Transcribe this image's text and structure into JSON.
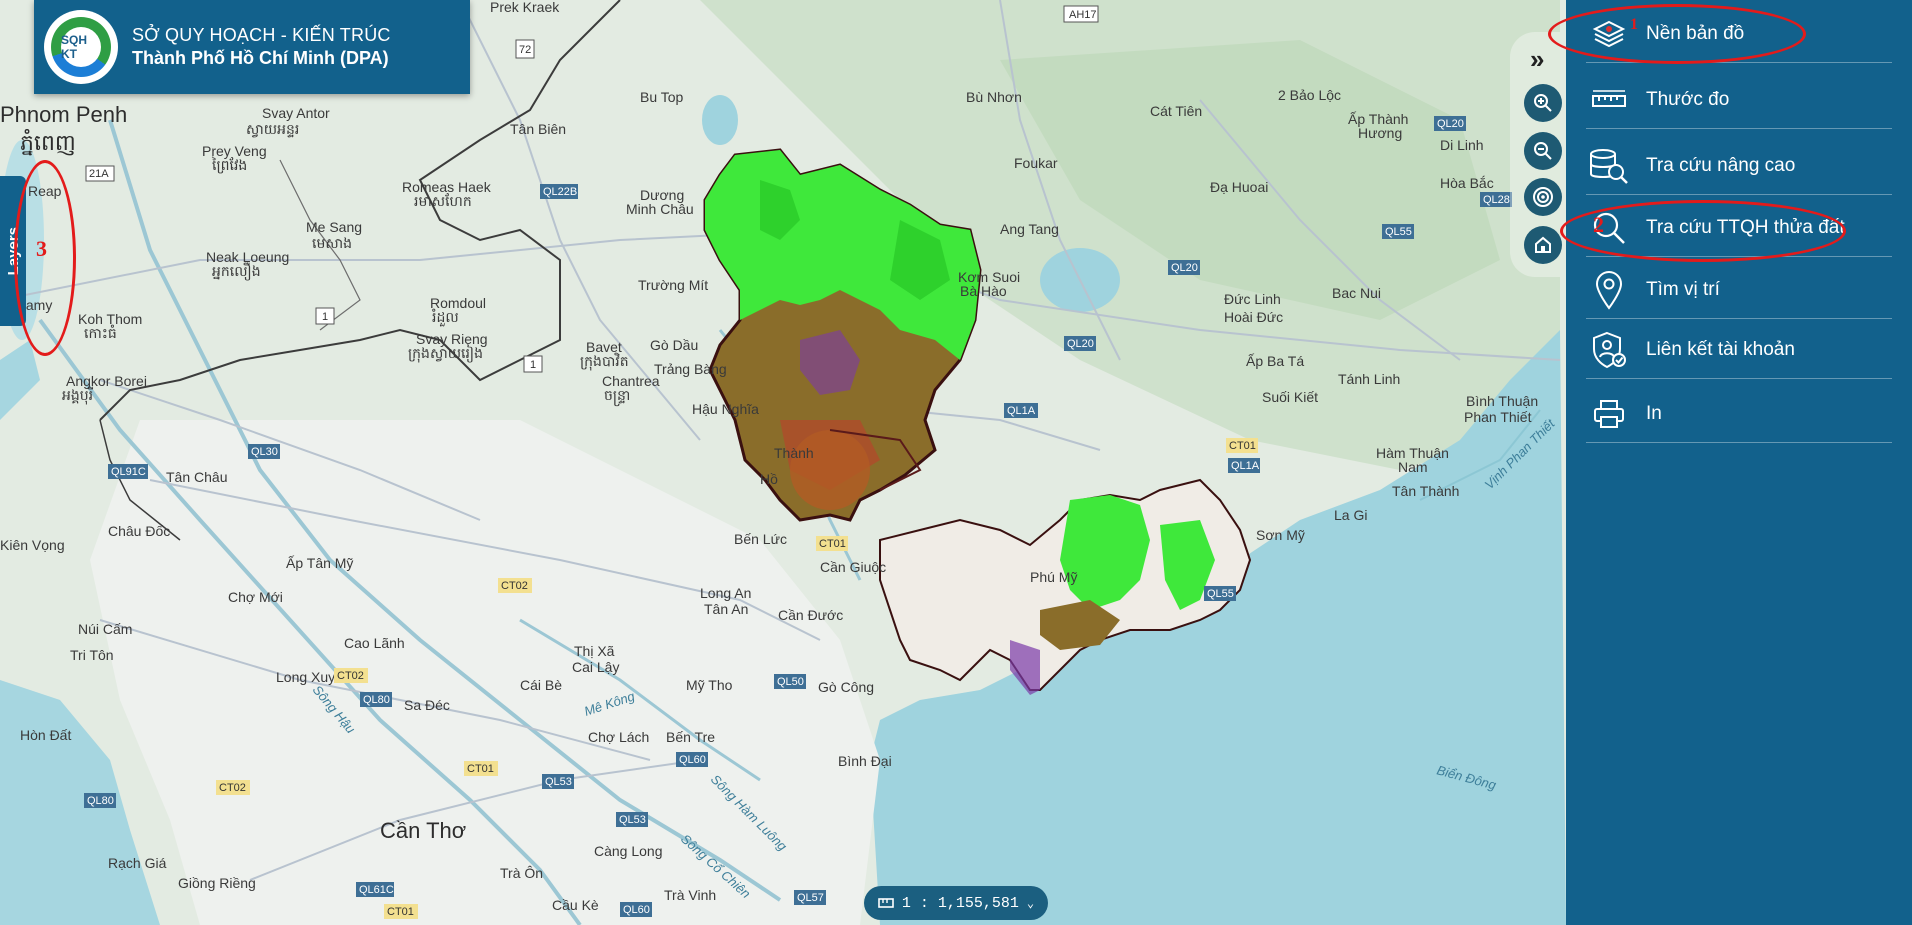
{
  "header": {
    "logo_text": "SQH KT",
    "line1": "SỞ QUY HOẠCH - KIẾN TRÚC",
    "line2": "Thành Phố Hồ Chí Minh (DPA)"
  },
  "layers_tab": {
    "label": "Layers"
  },
  "map_tools": [
    {
      "name": "zoom-in",
      "icon": "zoom-in-icon"
    },
    {
      "name": "zoom-out",
      "icon": "zoom-out-icon"
    },
    {
      "name": "locate",
      "icon": "target-icon"
    },
    {
      "name": "home",
      "icon": "home-icon"
    }
  ],
  "panel": {
    "expand_glyph": "»",
    "items": [
      {
        "label": "Nền bản đồ",
        "icon": "layers-icon"
      },
      {
        "label": "Thước đo",
        "icon": "ruler-icon"
      },
      {
        "label": "Tra cứu nâng cao",
        "icon": "database-search-icon"
      },
      {
        "label": "Tra cứu TTQH thửa đất",
        "icon": "search-icon"
      },
      {
        "label": "Tìm vị trí",
        "icon": "location-pin-icon"
      },
      {
        "label": "Liên kết tài khoản",
        "icon": "shield-user-icon"
      },
      {
        "label": "In",
        "icon": "printer-icon"
      }
    ]
  },
  "scale": {
    "value": "1 : 1,155,581"
  },
  "annotations": [
    {
      "number": "1",
      "target": "Nền bản đồ"
    },
    {
      "number": "2",
      "target": "Tra cứu TTQH thửa đất"
    },
    {
      "number": "3",
      "target": "Layers"
    }
  ],
  "map_labels": {
    "cities": [
      "Phnom Penh",
      "ភ្នំពេញ",
      "Cần Thơ",
      "Thành phố Hồ Chí Minh"
    ],
    "places": [
      "Prek Kraek",
      "Svay Antor",
      "ស្វាយអន្ទរ",
      "Prey Veng",
      "ព្រៃវែង",
      "Reap",
      "ស្វាយរៀង",
      "Me Sang",
      "មេសាង",
      "Romeas Haek",
      "រមាសហែក",
      "Neak Loeung",
      "អ្នកលឿង",
      "Koh Thom",
      "កោះធំ",
      "Romdoul",
      "រំដួល",
      "Svay Rieng",
      "ក្រុងស្វាយរៀង",
      "Bavet",
      "ក្រុងបាវិត",
      "Chantrea",
      "ចន្ទ្រា",
      "Angkor Borei",
      "អង្គបុរី",
      "Tân Biên",
      "Bu Top",
      "Dương Minh Châu",
      "Trường Mít",
      "Gò Dầu",
      "Trảng Bàng",
      "Hậu Nghĩa",
      "Bến Lức",
      "Cần Giuộc",
      "Cần Đước",
      "Long An",
      "Tân An",
      "Bù Nhơn",
      "Foukar",
      "Cát Tiên",
      "2 Bảo Lộc",
      "Ấp Thành Hương",
      "Di Linh",
      "Hòa Bắc",
      "Đạ Huoai",
      "Ang Tang",
      "Kơm Suoi Bà Hào",
      "Đức Linh",
      "Hoài Đức",
      "Bac Nui",
      "Ấp Ba Tá",
      "Tánh Linh",
      "Suối Kiết",
      "Bình Thuận Phan Thiết",
      "Hàm Thuận Nam",
      "Tân Thành",
      "La Gi",
      "Sơn Mỹ",
      "Phú Mỹ",
      "Tân Châu",
      "Châu Đốc",
      "Ấp Tân Mỹ",
      "Chợ Mới",
      "Núi Cấm",
      "Tri Tôn",
      "Cao Lãnh",
      "Long Xuyên",
      "Sa Đéc",
      "Cái Bè",
      "Mỹ Tho",
      "Gò Công",
      "Thị Xã Cai Lậy",
      "Chợ Lách",
      "Bến Tre",
      "Bình Đại",
      "Hòn Đất",
      "Rạch Giá",
      "Giồng Riềng",
      "Càng Long",
      "Trà Ôn",
      "Trà Vinh",
      "Cầu Kè",
      "Kiên Vọng",
      "Chamy"
    ],
    "water": [
      "Mê Kông",
      "Sông Hậu",
      "Sông Hàm Luông",
      "Sông Cổ Chiên",
      "Biển Đông",
      "Vịnh Phan Thiết"
    ],
    "roads": [
      "AH17",
      "72",
      "QL22B",
      "21A",
      "1",
      "1",
      "QL91C",
      "QL30",
      "QL20",
      "QL28",
      "QL55",
      "QL20",
      "QL20",
      "QL1A",
      "CT01",
      "QL1A",
      "CT01",
      "QL55",
      "CT02",
      "CT02",
      "QL80",
      "CT01",
      "QL50",
      "QL60",
      "QL53",
      "QL53",
      "CT02",
      "QL80",
      "QL61C",
      "CT01",
      "QL60",
      "QL57"
    ]
  }
}
